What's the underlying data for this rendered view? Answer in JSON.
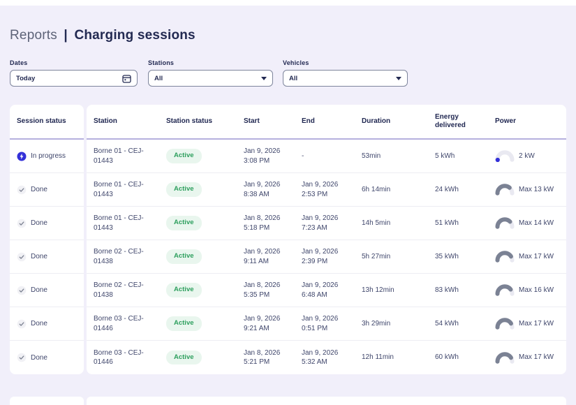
{
  "page": {
    "title_prefix": "Reports",
    "title_separator": "|",
    "title_main": "Charging sessions"
  },
  "filters": {
    "dates": {
      "label": "Dates",
      "value": "Today",
      "icon": "calendar-icon"
    },
    "stations": {
      "label": "Stations",
      "value": "All",
      "icon": "chevron-down-icon"
    },
    "vehicles": {
      "label": "Vehicles",
      "value": "All",
      "icon": "chevron-down-icon"
    }
  },
  "table": {
    "columns": {
      "session_status": "Session status",
      "station": "Station",
      "station_status": "Station status",
      "start": "Start",
      "end": "End",
      "duration": "Duration",
      "energy": "Energy delivered",
      "power": "Power"
    },
    "rows": [
      {
        "session_status": "In progress",
        "session_state": "in_progress",
        "station": "Borne 01 - CEJ-01443",
        "station_status": "Active",
        "start": {
          "date": "Jan 9, 2026",
          "time": "3:08 PM"
        },
        "end": {
          "date": "-",
          "time": ""
        },
        "duration": "53min",
        "energy": "5 kWh",
        "power": {
          "label": "2 kW",
          "type": "current",
          "fraction": 0
        }
      },
      {
        "session_status": "Done",
        "session_state": "done",
        "station": "Borne 01 - CEJ-01443",
        "station_status": "Active",
        "start": {
          "date": "Jan 9, 2026",
          "time": "8:38 AM"
        },
        "end": {
          "date": "Jan 9, 2026",
          "time": "2:53 PM"
        },
        "duration": "6h 14min",
        "energy": "24 kWh",
        "power": {
          "label": "Max 13 kW",
          "type": "max",
          "fraction": 0.72
        }
      },
      {
        "session_status": "Done",
        "session_state": "done",
        "station": "Borne 01 - CEJ-01443",
        "station_status": "Active",
        "start": {
          "date": "Jan 8, 2026",
          "time": "5:18 PM"
        },
        "end": {
          "date": "Jan 9, 2026",
          "time": "7:23 AM"
        },
        "duration": "14h 5min",
        "energy": "51 kWh",
        "power": {
          "label": "Max 14 kW",
          "type": "max",
          "fraction": 0.75
        }
      },
      {
        "session_status": "Done",
        "session_state": "done",
        "station": "Borne 02 - CEJ-01438",
        "station_status": "Active",
        "start": {
          "date": "Jan 9, 2026",
          "time": "9:11 AM"
        },
        "end": {
          "date": "Jan 9, 2026",
          "time": "2:39 PM"
        },
        "duration": "5h 27min",
        "energy": "35 kWh",
        "power": {
          "label": "Max 17 kW",
          "type": "max",
          "fraction": 0.82
        }
      },
      {
        "session_status": "Done",
        "session_state": "done",
        "station": "Borne 02 - CEJ-01438",
        "station_status": "Active",
        "start": {
          "date": "Jan 8, 2026",
          "time": "5:35 PM"
        },
        "end": {
          "date": "Jan 9, 2026",
          "time": "6:48 AM"
        },
        "duration": "13h 12min",
        "energy": "83 kWh",
        "power": {
          "label": "Max 16 kW",
          "type": "max",
          "fraction": 0.79
        }
      },
      {
        "session_status": "Done",
        "session_state": "done",
        "station": "Borne 03 - CEJ-01446",
        "station_status": "Active",
        "start": {
          "date": "Jan 9, 2026",
          "time": "9:21 AM"
        },
        "end": {
          "date": "Jan 9, 2026",
          "time": "0:51 PM"
        },
        "duration": "3h 29min",
        "energy": "54 kWh",
        "power": {
          "label": "Max 17 kW",
          "type": "max",
          "fraction": 0.82
        }
      },
      {
        "session_status": "Done",
        "session_state": "done",
        "station": "Borne 03 - CEJ-01446",
        "station_status": "Active",
        "start": {
          "date": "Jan 8, 2026",
          "time": "5:21 PM"
        },
        "end": {
          "date": "Jan 9, 2026",
          "time": "5:32 AM"
        },
        "duration": "12h 11min",
        "energy": "60 kWh",
        "power": {
          "label": "Max 17 kW",
          "type": "max",
          "fraction": 0.82
        }
      }
    ]
  },
  "colors": {
    "page_bg": "#f1effa",
    "accent_blue": "#3330d8",
    "active_green": "#2d9f5d",
    "active_green_bg": "#e9f6ee",
    "title_navy": "#232a52",
    "gauge_fill": "#7b8294",
    "gauge_track": "#e9e9f1",
    "header_underline": "#b6b0de"
  }
}
